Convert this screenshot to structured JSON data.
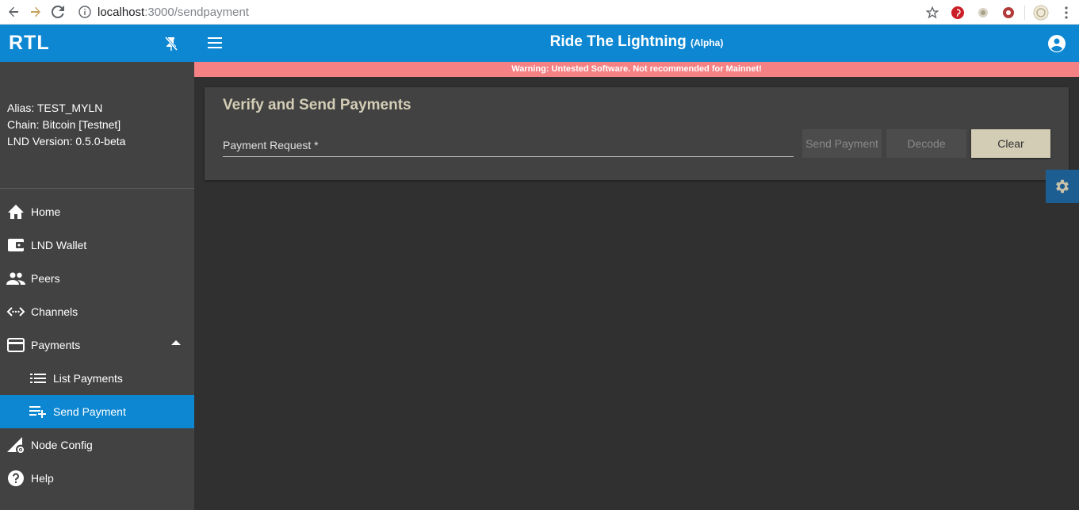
{
  "browser": {
    "url_host": "localhost",
    "url_path": ":3000/sendpayment"
  },
  "sidebar": {
    "brand": "RTL",
    "node_info": {
      "alias": "Alias: TEST_MYLN",
      "chain": "Chain: Bitcoin [Testnet]",
      "version": "LND Version: 0.5.0-beta"
    },
    "items": [
      {
        "label": "Home",
        "icon": "home-icon"
      },
      {
        "label": "LND Wallet",
        "icon": "wallet-icon"
      },
      {
        "label": "Peers",
        "icon": "people-icon"
      },
      {
        "label": "Channels",
        "icon": "settings-ethernet-icon"
      },
      {
        "label": "Payments",
        "icon": "credit-card-icon"
      },
      {
        "label": "List Payments",
        "icon": "list-icon"
      },
      {
        "label": "Send Payment",
        "icon": "playlist-add-icon"
      },
      {
        "label": "Node Config",
        "icon": "network-settings-icon"
      },
      {
        "label": "Help",
        "icon": "help-icon"
      }
    ]
  },
  "header": {
    "title": "Ride The Lightning",
    "badge": "(Alpha)",
    "warning": "Warning: Untested Software. Not recommended for Mainnet!"
  },
  "main": {
    "card_title": "Verify and Send Payments",
    "payment_request_label": "Payment Request *",
    "payment_request_value": "",
    "buttons": {
      "send_payment": "Send Payment",
      "decode": "Decode",
      "clear": "Clear"
    }
  },
  "colors": {
    "primary": "#0d87d2",
    "accent": "#d4cdb6",
    "warning": "#f48184",
    "background": "#303030",
    "sidebar": "#424242"
  }
}
